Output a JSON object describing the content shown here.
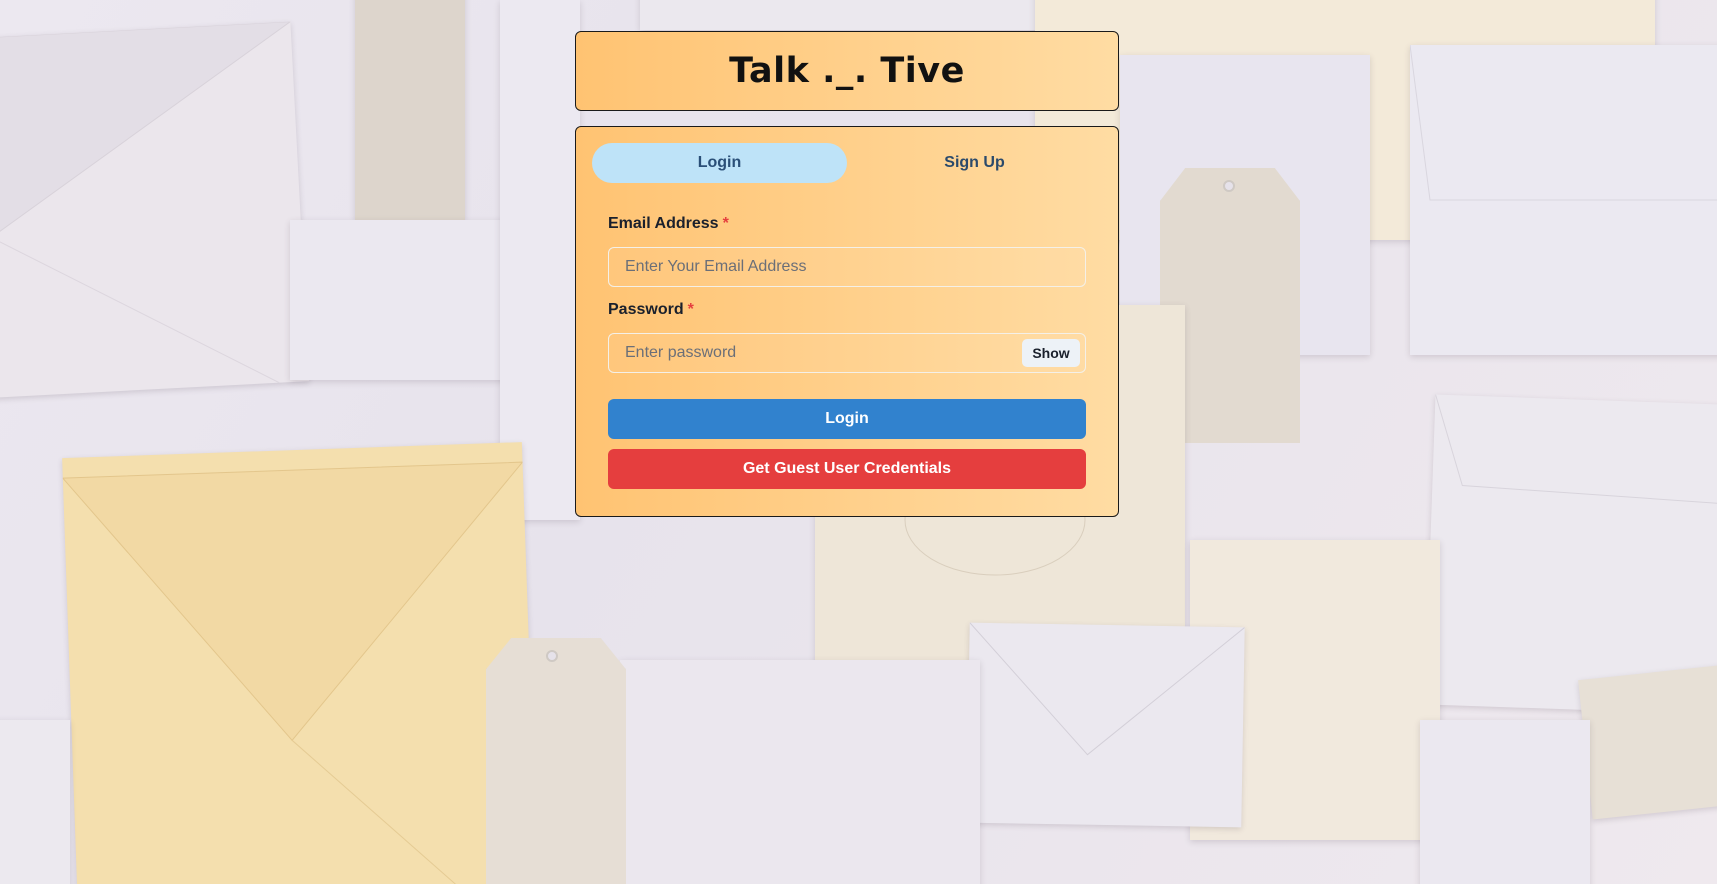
{
  "header": {
    "title": "Talk ._. Tive"
  },
  "tabs": [
    {
      "label": "Login",
      "active": true
    },
    {
      "label": "Sign Up",
      "active": false
    }
  ],
  "form": {
    "email": {
      "label": "Email Address",
      "required_mark": "*",
      "placeholder": "Enter Your Email Address",
      "value": ""
    },
    "password": {
      "label": "Password",
      "required_mark": "*",
      "placeholder": "Enter password",
      "value": "",
      "toggle_label": "Show"
    },
    "login_button": "Login",
    "guest_button": "Get Guest User Credentials"
  },
  "colors": {
    "card_gradient_start": "#ffc372",
    "card_gradient_end": "#ffdca3",
    "tab_active_bg": "#bee3f8",
    "login_button": "#3182ce",
    "guest_button": "#e53e3e",
    "required_mark": "#e53e3e"
  },
  "background": {
    "icon": "envelopes-background-image"
  }
}
